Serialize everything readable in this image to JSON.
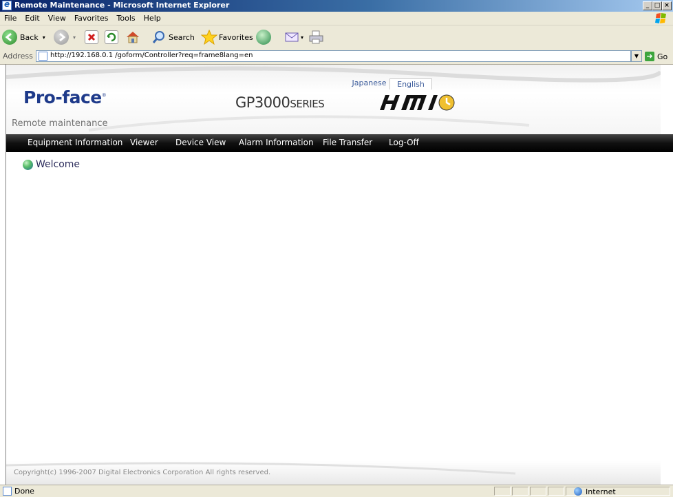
{
  "window": {
    "title": "Remote Maintenance - Microsoft Internet Explorer",
    "controls": {
      "minimize": "_",
      "maximize": "□",
      "close": "×"
    }
  },
  "menu": [
    "File",
    "Edit",
    "View",
    "Favorites",
    "Tools",
    "Help"
  ],
  "toolbar": {
    "back_label": "Back",
    "search_label": "Search",
    "favorites_label": "Favorites"
  },
  "address": {
    "label": "Address",
    "url": "http://192.168.0.1 /goform/Controller?req=frame8lang=en",
    "go_label": "Go"
  },
  "page": {
    "lang_japanese": "Japanese",
    "lang_english": "English",
    "logo_text": "Pro-face",
    "series_main": "GP3000",
    "series_suffix": "SERIES",
    "section_title": "Remote maintenance",
    "nav": [
      "Equipment Information",
      "Viewer",
      "Device View",
      "Alarm Information",
      "File Transfer",
      "Log-Off"
    ],
    "welcome": "Welcome",
    "copyright": "Copyright(c) 1996-2007 Digital Electronics Corporation All rights reserved."
  },
  "status": {
    "left": "Done",
    "zone": "Internet"
  },
  "colors": {
    "titlebar": "#0a246a",
    "nav_bg": "#000000",
    "brand": "#1e3a8a"
  }
}
